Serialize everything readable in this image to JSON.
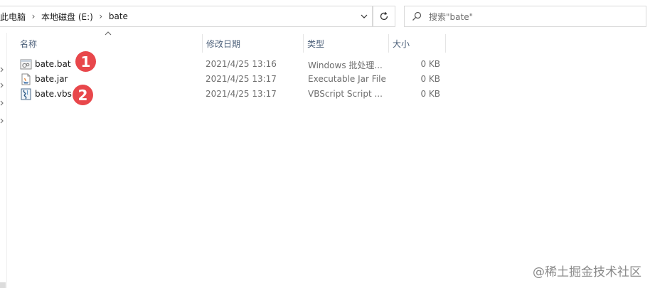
{
  "address_bar": {
    "crumbs": [
      "此电脑",
      "本地磁盘 (E:)",
      "bate"
    ],
    "dropdown_icon": "chevron-down-icon"
  },
  "refresh_icon": "refresh-icon",
  "search": {
    "placeholder": "搜索\"bate\"",
    "icon": "search-icon"
  },
  "columns": {
    "name": "名称",
    "date": "修改日期",
    "type": "类型",
    "size": "大小"
  },
  "files": [
    {
      "name": "bate.bat",
      "date": "2021/4/25 13:16",
      "type": "Windows 批处理...",
      "size": "0 KB",
      "icon": "batch-file-icon"
    },
    {
      "name": "bate.jar",
      "date": "2021/4/25 13:17",
      "type": "Executable Jar File",
      "size": "0 KB",
      "icon": "jar-file-icon"
    },
    {
      "name": "bate.vbs",
      "date": "2021/4/25 13:17",
      "type": "VBScript Script ...",
      "size": "0 KB",
      "icon": "vbs-file-icon"
    }
  ],
  "markers": [
    "1",
    "2"
  ],
  "marker_color": "#e8474b",
  "watermark": "@稀土掘金技术社区"
}
